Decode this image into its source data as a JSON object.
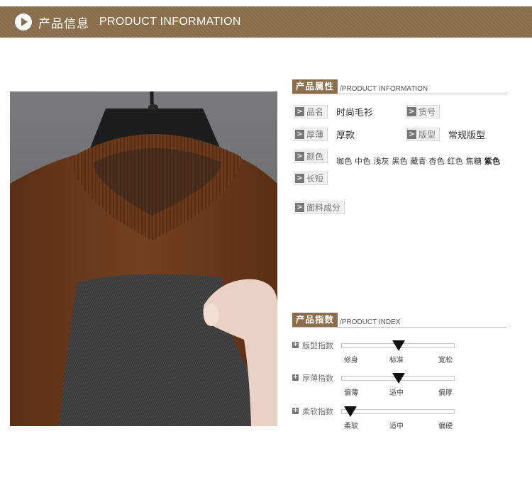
{
  "banner": {
    "title_cn": "产品信息",
    "title_en": "PRODUCT INFORMATION"
  },
  "attributes": {
    "title_cn": "产品属性",
    "title_en": "/PRODUCT INFORMATION",
    "name_label": "品名",
    "name_value": "时尚毛衫",
    "sku_label": "货号",
    "thickness_label": "厚薄",
    "thickness_value": "厚款",
    "fit_label": "版型",
    "fit_value": "常规版型",
    "color_label": "颜色",
    "colors": "咖色 中色 浅灰 黑色 藏青 杏色 红色 焦糖",
    "color_last": "紫色",
    "length_label": "长短",
    "fabric_label": "面料成分"
  },
  "index": {
    "title_cn": "产品指数",
    "title_en": "/PRODUCT INDEX",
    "rows": [
      {
        "label": "版型指数",
        "left": "修身",
        "mid": "标准",
        "right": "宽松",
        "level": 0.5
      },
      {
        "label": "厚薄指数",
        "left": "偏薄",
        "mid": "适中",
        "right": "偏厚",
        "level": 0.5
      },
      {
        "label": "柔软指数",
        "left": "柔软",
        "mid": "适中",
        "right": "偏硬",
        "level": 0.0
      }
    ]
  },
  "icons": {
    "banner": "play-circle-icon",
    "badge": "chevron-right-icon",
    "index": "plus-box-icon"
  },
  "colors": {
    "brand": "#8b6f4c",
    "sweater": "#6b3a1d",
    "fleece": "#3a3a3a"
  }
}
